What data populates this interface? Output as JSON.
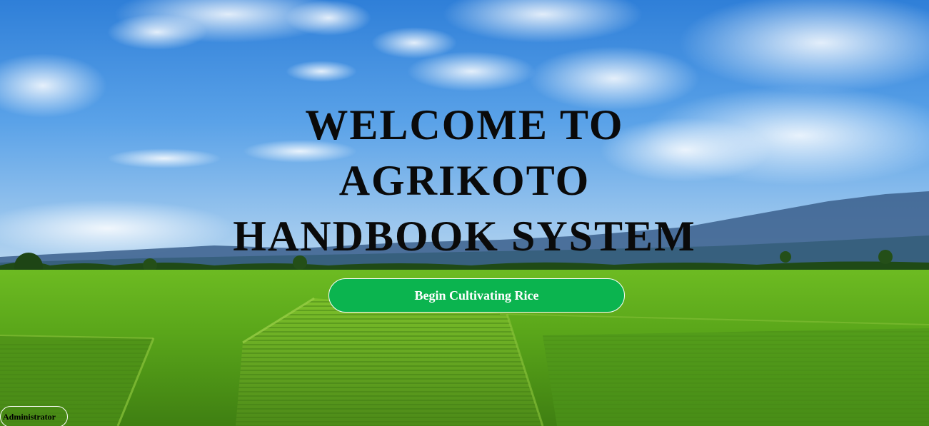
{
  "hero": {
    "title_lines": [
      "WELCOME TO",
      "AGRIKOTO",
      "HANDBOOK SYSTEM"
    ],
    "cta_label": "Begin Cultivating Rice",
    "background": "rice-field-landscape-photo"
  },
  "footer": {
    "admin_label": "Administrator"
  },
  "colors": {
    "cta_background": "#0bb44f",
    "cta_text": "#ffffff",
    "title_text": "#0a0a0a",
    "sky": "#3f8fe0",
    "field": "#5fae1f"
  }
}
